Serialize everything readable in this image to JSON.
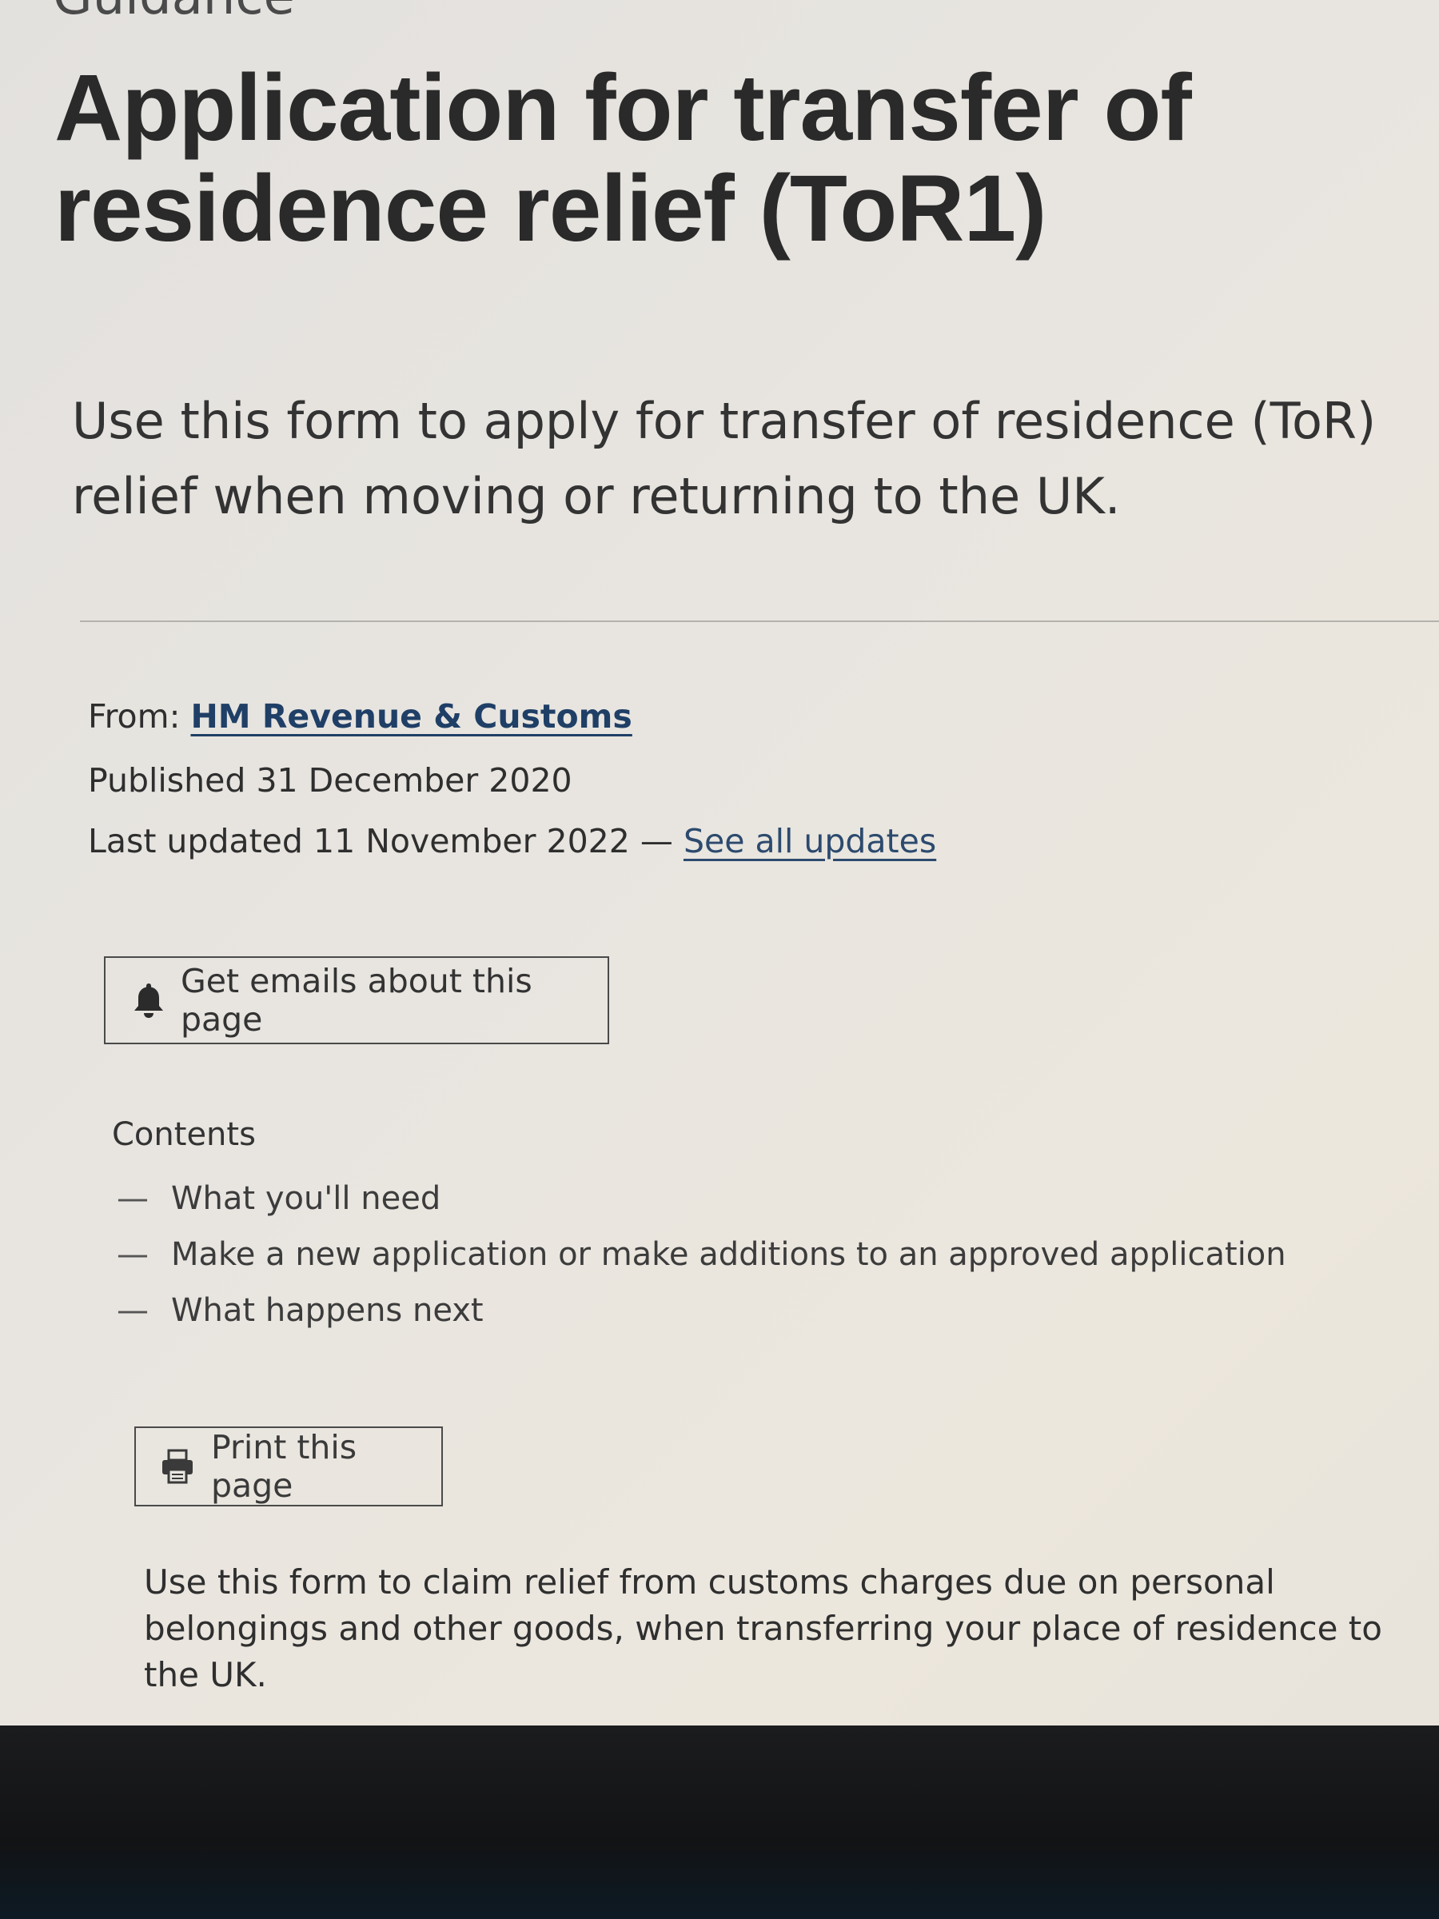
{
  "page": {
    "caption": "Guidance",
    "title": "Application for transfer of residence relief (ToR1)",
    "lede": "Use this form to apply for transfer of residence (ToR) relief when moving or returning to the UK."
  },
  "metadata": {
    "from_label": "From:",
    "from_link": "HM Revenue & Customs",
    "published_label": "Published",
    "published_date": "31 December 2020",
    "updated_label": "Last updated",
    "updated_date": "11 November 2022",
    "separator": "—",
    "see_all_updates": "See all updates"
  },
  "actions": {
    "emails_label": "Get emails about this page",
    "emails_icon": "bell-icon",
    "print_label": "Print this page",
    "print_icon": "printer-icon"
  },
  "contents": {
    "heading": "Contents",
    "items": [
      {
        "dash": "—",
        "label": "What you'll need"
      },
      {
        "dash": "—",
        "label": "Make a new application or make additions to an approved application"
      },
      {
        "dash": "—",
        "label": "What happens next"
      }
    ]
  },
  "body": {
    "paragraph": "Use this form to claim relief from customs charges due on personal belongings and other goods, when transferring your place of residence to the UK."
  },
  "colors": {
    "link": "#1f3f66",
    "text": "#2b2b2b",
    "bezel": "#121315"
  }
}
